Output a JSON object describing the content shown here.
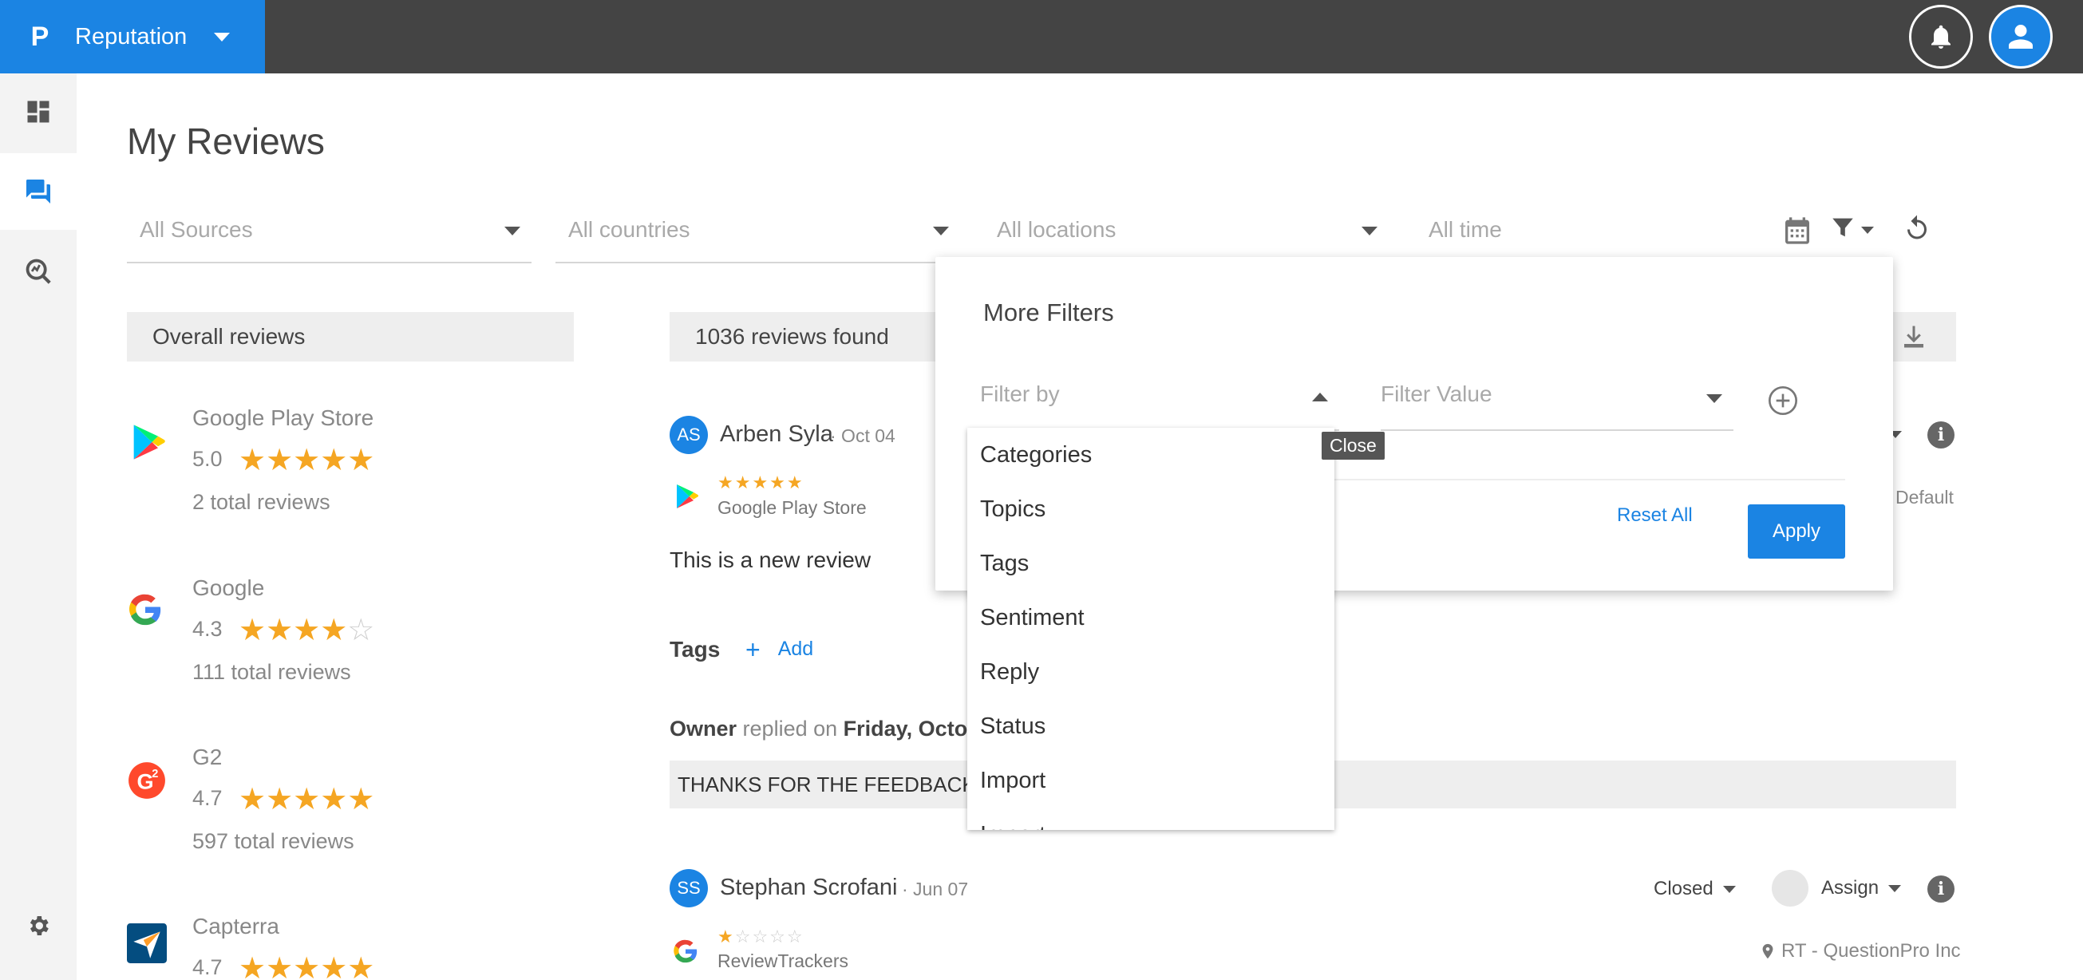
{
  "header": {
    "app_name": "Reputation",
    "logo_letter": "P"
  },
  "page": {
    "title": "My Reviews"
  },
  "filters": {
    "sources": "All Sources",
    "countries": "All countries",
    "locations": "All locations",
    "time": "All time"
  },
  "overall": {
    "heading": "Overall reviews",
    "sources": [
      {
        "name": "Google Play Store",
        "rating": "5.0",
        "stars": 5,
        "total": "2 total reviews",
        "icon": "google-play-icon"
      },
      {
        "name": "Google",
        "rating": "4.3",
        "stars": 4.3,
        "total": "111 total reviews",
        "icon": "google-icon"
      },
      {
        "name": "G2",
        "rating": "4.7",
        "stars": 4.7,
        "total": "597 total reviews",
        "icon": "g2-icon"
      },
      {
        "name": "Capterra",
        "rating": "4.7",
        "stars": 4.7,
        "total": "",
        "icon": "capterra-icon"
      }
    ]
  },
  "reviews": {
    "count_label": "1036 reviews found",
    "items": [
      {
        "initials": "AS",
        "name": "Arben Syla",
        "date": "· Oct 04",
        "stars": 5,
        "source": "Google Play Store",
        "text": "This is a new review",
        "tags_label": "Tags",
        "add_label": "Add",
        "reply_owner": "Owner",
        "reply_mid": "replied on",
        "reply_date": "Friday, Octo",
        "reply_text": "THANKS FOR THE FEEDBACK",
        "location": "Default"
      },
      {
        "initials": "SS",
        "name": "Stephan Scrofani",
        "date": "· Jun 07",
        "stars": 1,
        "source": "ReviewTrackers",
        "status": "Closed",
        "assign": "Assign",
        "location": "RT - QuestionPro Inc"
      }
    ]
  },
  "more_filters": {
    "title": "More Filters",
    "filter_by_placeholder": "Filter by",
    "filter_value_placeholder": "Filter Value",
    "reset_label": "Reset All",
    "apply_label": "Apply",
    "tooltip": "Close",
    "options": [
      "Categories",
      "Topics",
      "Tags",
      "Sentiment",
      "Reply",
      "Status",
      "Import",
      "Import…"
    ]
  },
  "colors": {
    "brand": "#1b84e3",
    "topbar": "#444444",
    "star": "#f5a623"
  }
}
